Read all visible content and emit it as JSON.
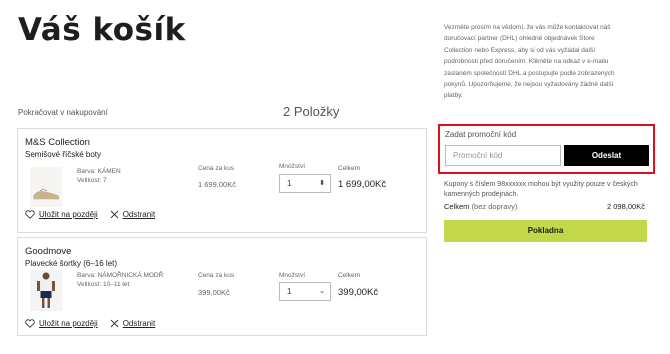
{
  "page": {
    "title": "Váš košík",
    "continue_shopping": "Pokračovat v nakupování",
    "item_count": "2 Položky"
  },
  "columns": {
    "unit_price": "Cena za kus",
    "quantity": "Množství",
    "total": "Celkem"
  },
  "items": [
    {
      "brand": "M&S Collection",
      "name": "Semišové říčské boty",
      "color_line": "Barva: KÁMEN",
      "size_line": "Velikost: 7",
      "unit_price": "1 699,00Kč",
      "quantity": "1",
      "total": "1 699,00Kč",
      "save_later": "Uložit na později",
      "remove": "Odstranit"
    },
    {
      "brand": "Goodmove",
      "name": "Plavecké šortky (6–16 let)",
      "color_line": "Barva: NÁMOŘNICKÁ MODŘ",
      "size_line": "Velikost: 10–11 let",
      "unit_price": "399,00Kč",
      "quantity": "1",
      "total": "399,00Kč",
      "save_later": "Uložit na později",
      "remove": "Odstranit"
    }
  ],
  "sidebar": {
    "notice_lines": [
      "Vezměte prosím na vědomí, že vás může kontaktovat náš",
      "doručovací partner (DHL) ohledně objednávek Store",
      "Collection nebo Express, aby si od vás vyžádal další",
      "podrobnosti před doručením. Klikněte na odkaz v e-mailu",
      "zaslaném společností DHL a postupujte podle zobrazených",
      "pokynů. Upozorňujeme, že nejsou vyžadovány žádné další",
      "platby."
    ],
    "promo_label": "Zadat promoční kód",
    "promo_placeholder": "Promoční kód",
    "promo_button": "Odeslat",
    "coupon_note": "Kupony s číslem 98xxxxxx mohou být využity pouze v českých kamenných prodejnách.",
    "total_label": "Celkem",
    "total_note": "(bez dopravy)",
    "total_value": "2 098,00Kč",
    "checkout_button": "Pokladna"
  },
  "colors": {
    "highlight_border": "#d9121b",
    "checkout_bg": "#c2d84a",
    "submit_bg": "#000000"
  }
}
